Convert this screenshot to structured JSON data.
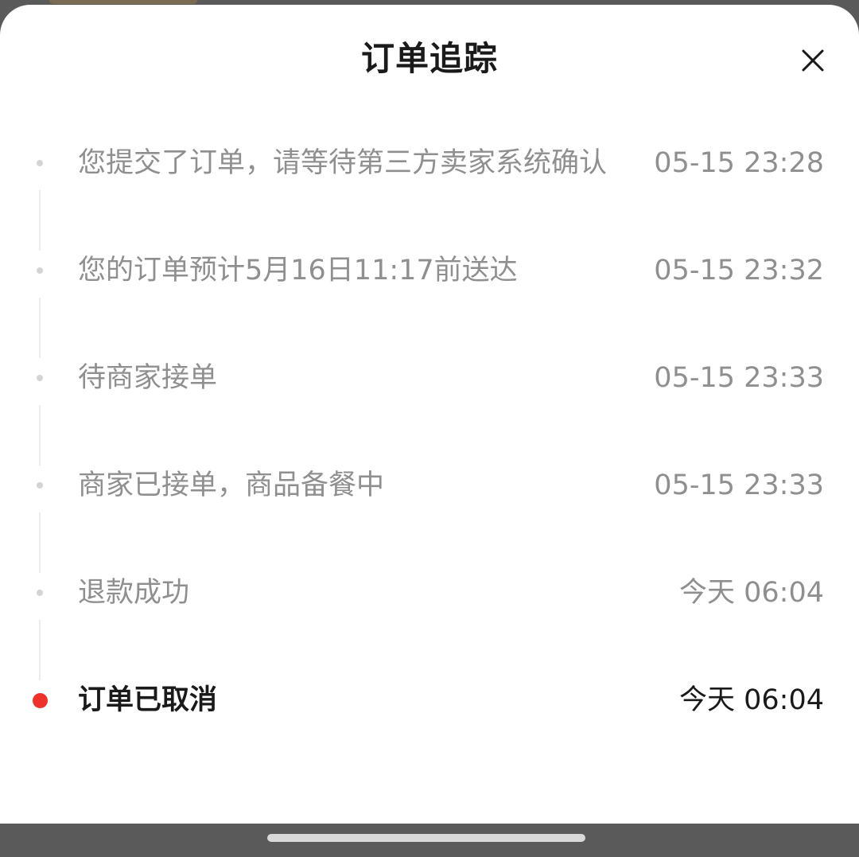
{
  "sheet": {
    "title": "订单追踪",
    "close_icon": "close-icon"
  },
  "timeline": [
    {
      "text": "您提交了订单，请等待第三方卖家系统确认",
      "time": "05-15 23:28",
      "active": false
    },
    {
      "text": "您的订单预计5月16日11:17前送达",
      "time": "05-15 23:32",
      "active": false
    },
    {
      "text": "待商家接单",
      "time": "05-15 23:33",
      "active": false
    },
    {
      "text": "商家已接单，商品备餐中",
      "time": "05-15 23:33",
      "active": false
    },
    {
      "text": "退款成功",
      "time": "今天 06:04",
      "active": false
    },
    {
      "text": "订单已取消",
      "time": "今天 06:04",
      "active": true
    }
  ],
  "colors": {
    "active_dot": "#f0302a",
    "inactive_dot": "#d4d4d4",
    "inactive_text": "#8f8f8f",
    "active_text": "#1a1a1a"
  }
}
